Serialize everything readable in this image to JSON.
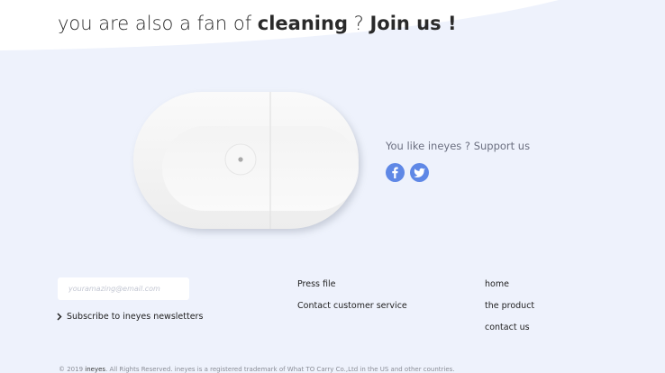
{
  "headline": {
    "prefix": "you are also a fan of ",
    "emphasis": "cleaning",
    "middle": " ? ",
    "cta": "Join us !"
  },
  "support": {
    "text": "You like ineyes ? Support us",
    "social": [
      {
        "icon": "facebook-icon",
        "glyph": "f",
        "color": "#5f88e6"
      },
      {
        "icon": "twitter-icon",
        "color": "#5f88e6"
      }
    ]
  },
  "newsletter": {
    "placeholder": "youramazing@email.com",
    "subscribe_label": "Subscribe to ineyes newsletters",
    "arrow_icon": "chevron-right-icon"
  },
  "footer": {
    "col1": [
      "Press file",
      "Contact customer service"
    ],
    "col2": [
      "home",
      "the product",
      "contact us"
    ]
  },
  "copyright": {
    "prefix": "© 2019 ",
    "brand": "ineyes",
    "suffix": ". All Rights Reserved. ineyes is a registered trademark of What TO Carry Co.,Ltd in the US and other countries."
  },
  "colors": {
    "background": "#eef2fc",
    "accent": "#5f88e6",
    "device": "#f5f5f5"
  }
}
